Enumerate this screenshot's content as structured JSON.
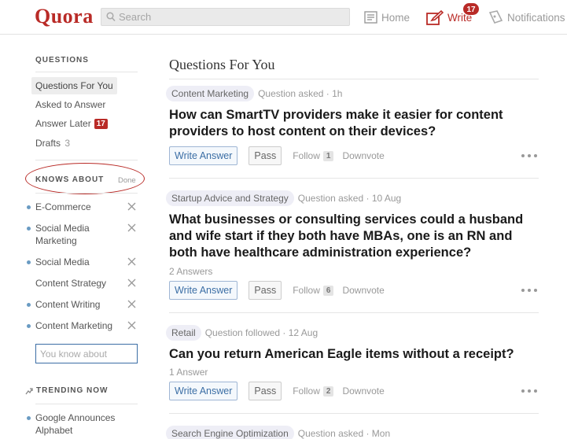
{
  "header": {
    "logo": "Quora",
    "search_placeholder": "Search",
    "nav_home": "Home",
    "nav_write": "Write",
    "write_badge": "17",
    "nav_notifications": "Notifications"
  },
  "sidebar": {
    "questions_title": "QUESTIONS",
    "links": {
      "questions_for_you": "Questions For You",
      "asked_to_answer": "Asked to Answer",
      "answer_later": "Answer Later",
      "answer_later_count": "17",
      "drafts": "Drafts",
      "drafts_count": "3"
    },
    "knows_about_title": "KNOWS ABOUT",
    "done_label": "Done",
    "topics": [
      "E-Commerce",
      "Social Media Marketing",
      "Social Media",
      "Content Strategy",
      "Content Writing",
      "Content Marketing"
    ],
    "topic_input_placeholder": "You know about",
    "trending_title": "TRENDING NOW",
    "trending": [
      "Google Announces Alphabet"
    ]
  },
  "main": {
    "title": "Questions For You",
    "questions": [
      {
        "tag": "Content Marketing",
        "meta": "Question asked · 1h",
        "title": "How can SmartTV providers make it easier for content providers to host content on their devices?",
        "answers": "",
        "follow_count": "1"
      },
      {
        "tag": "Startup Advice and Strategy",
        "meta": "Question asked · 10 Aug",
        "title": "What businesses or consulting services could a husband and wife start if they both have MBAs, one is an RN and both have healthcare administration experience?",
        "answers": "2 Answers",
        "follow_count": "6"
      },
      {
        "tag": "Retail",
        "meta": "Question followed · 12 Aug",
        "title": "Can you return American Eagle items without a receipt?",
        "answers": "1 Answer",
        "follow_count": "2"
      },
      {
        "tag": "Search Engine Optimization",
        "meta": "Question asked · Mon"
      }
    ],
    "actions": {
      "write_answer": "Write Answer",
      "pass": "Pass",
      "follow": "Follow",
      "downvote": "Downvote"
    }
  },
  "colors": {
    "brand": "#b92b27",
    "link_blue": "#3b6ea5"
  }
}
